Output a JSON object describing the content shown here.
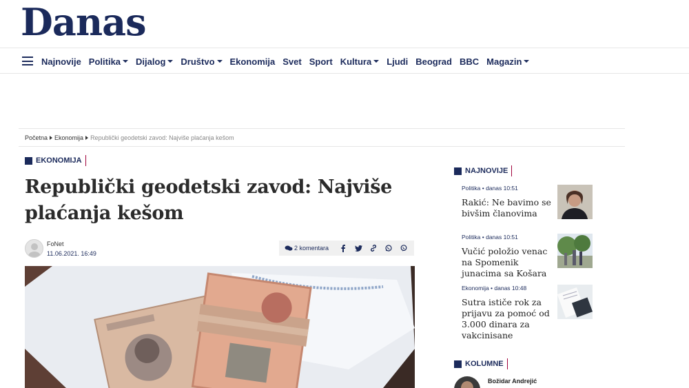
{
  "brand": {
    "logo": "Danas"
  },
  "nav": {
    "items": [
      {
        "label": "Najnovije",
        "dropdown": false
      },
      {
        "label": "Politika",
        "dropdown": true
      },
      {
        "label": "Dijalog",
        "dropdown": true
      },
      {
        "label": "Društvo",
        "dropdown": true
      },
      {
        "label": "Ekonomija",
        "dropdown": false
      },
      {
        "label": "Svet",
        "dropdown": false
      },
      {
        "label": "Sport",
        "dropdown": false
      },
      {
        "label": "Kultura",
        "dropdown": true
      },
      {
        "label": "Ljudi",
        "dropdown": false
      },
      {
        "label": "Beograd",
        "dropdown": false
      },
      {
        "label": "BBC",
        "dropdown": false
      },
      {
        "label": "Magazin",
        "dropdown": true
      }
    ]
  },
  "breadcrumb": {
    "home": "Početna",
    "section": "Ekonomija",
    "current": "Republički geodetski zavod: Najviše plaćanja kešom"
  },
  "article": {
    "category": "EKONOMIJA",
    "title": "Republički geodetski zavod: Najviše plaćanja kešom",
    "author": "FoNet",
    "date": "11.06.2021. 16:49",
    "comments": "2 komentara"
  },
  "share_icons": [
    "facebook-icon",
    "twitter-icon",
    "link-icon",
    "whatsapp-icon",
    "viber-icon"
  ],
  "sidebar": {
    "latest_heading": "NAJNOVIJE",
    "latest": [
      {
        "meta": "Politika • danas 10:51",
        "title": "Rakić: Ne bavimo se bivšim članovima"
      },
      {
        "meta": "Politika • danas 10:51",
        "title": "Vučić položio venac na Spomenik junacima sa Košara"
      },
      {
        "meta": "Ekonomija • danas 10:48",
        "title": "Sutra ističe rok za prijavu za pomoć od 3.000 dinara za vakcinisane"
      }
    ],
    "columns_heading": "KOLUMNE",
    "column_author": "Božidar Andrejić"
  },
  "colors": {
    "brand_navy": "#1b2a5b",
    "accent": "#a0003a"
  }
}
